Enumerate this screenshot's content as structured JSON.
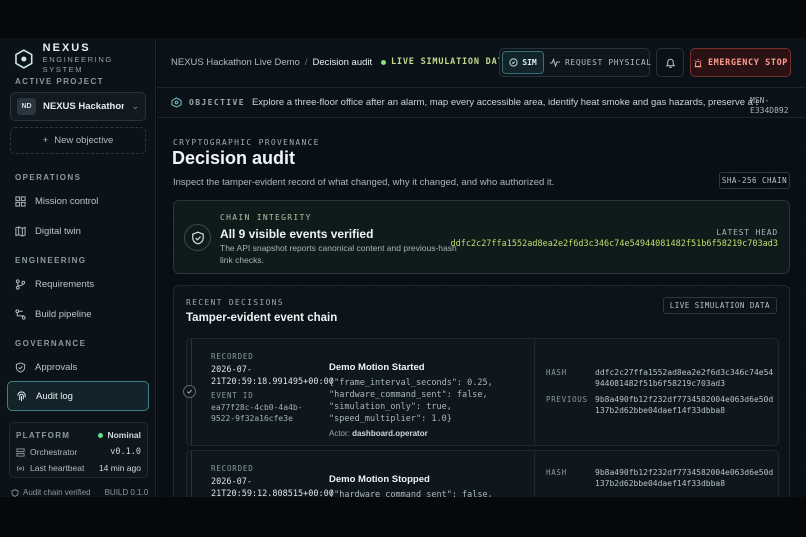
{
  "brand": {
    "name": "NEXUS",
    "subtitle": "ENGINEERING SYSTEM"
  },
  "sidebar": {
    "active_project_label": "ACTIVE PROJECT",
    "project": {
      "badge": "ND",
      "name": "NEXUS Hackathon ..."
    },
    "new_objective": "New objective",
    "sections": {
      "operations": "OPERATIONS",
      "engineering": "ENGINEERING",
      "governance": "GOVERNANCE"
    },
    "items": {
      "mission_control": "Mission control",
      "digital_twin": "Digital twin",
      "requirements": "Requirements",
      "build_pipeline": "Build pipeline",
      "approvals": "Approvals",
      "audit_log": "Audit log"
    },
    "platform": {
      "label": "PLATFORM",
      "status": "Nominal",
      "orchestrator_label": "Orchestrator",
      "orchestrator_version": "v0.1.0",
      "heartbeat_label": "Last heartbeat",
      "heartbeat_value": "14 min ago"
    },
    "footer": {
      "chain": "Audit chain verified",
      "build": "BUILD 0.1.0"
    }
  },
  "header": {
    "breadcrumb_parent": "NEXUS Hackathon Live Demo",
    "breadcrumb_sep": "/",
    "breadcrumb_current": "Decision audit",
    "live_badge": "LIVE SIMULATION DATA",
    "sim_label": "SIM",
    "request_label": "REQUEST PHYSICAL",
    "estop_label": "EMERGENCY STOP"
  },
  "objective": {
    "label": "OBJECTIVE",
    "text": "Explore a three-floor office after an alarm, map every accessible area, identify heat smoke and gas hazards, preserve a safe egress",
    "mission_id_line1": "MSN-",
    "mission_id_line2": "E334D892"
  },
  "page": {
    "eyebrow": "CRYPTOGRAPHIC PROVENANCE",
    "title": "Decision audit",
    "subtitle": "Inspect the tamper-evident record of what changed, why it changed, and who authorized it.",
    "sha_tag": "SHA-256 CHAIN"
  },
  "integrity": {
    "label": "CHAIN INTEGRITY",
    "title": "All 9 visible events verified",
    "description": "The API snapshot reports canonical content and previous-hash link checks.",
    "head_label": "LATEST HEAD",
    "head_hash": "ddfc2c27ffa1552ad8ea2e2f6d3c346c74e54944081482f51b6f58219c703ad3"
  },
  "recent": {
    "label": "RECENT DECISIONS",
    "title": "Tamper-evident event chain",
    "live_tag": "LIVE SIMULATION DATA",
    "recorded_label": "RECORDED",
    "event_id_label": "EVENT ID",
    "hash_label": "HASH",
    "previous_label": "PREVIOUS",
    "events": [
      {
        "time": "2026-07-21T20:59:18.991495+00:00",
        "event_id": "ea77f28c-4cb0-4a4b-9522-9f32a16cfe3e",
        "title": "Demo Motion Started",
        "payload": "{\"frame_interval_seconds\": 0.25, \"hardware_command_sent\": false, \"simulation_only\": true, \"speed_multiplier\": 1.0}",
        "actor_label": "Actor:",
        "actor": "dashboard.operator",
        "hash": "ddfc2c27ffa1552ad8ea2e2f6d3c346c74e54944081482f51b6f58219c703ad3",
        "previous": "9b8a490fb12f232df7734582004e063d6e50d137b2d62bbe04daef14f33dbba8"
      },
      {
        "time": "2026-07-21T20:59:12.808515+00:00",
        "title": "Demo Motion Stopped",
        "payload": "{\"hardware_command_sent\": false,",
        "hash": "9b8a490fb12f232df7734582004e063d6e50d137b2d62bbe04daef14f33dbba8"
      }
    ]
  },
  "colors": {
    "accent_teal": "#3f7f8a",
    "hash_green": "#b8e06b",
    "estop_red": "#ff9c8f",
    "status_green": "#5ee38a"
  },
  "icons": {
    "brand": "hexagon-icon",
    "mission_control": "grid-icon",
    "digital_twin": "map-icon",
    "requirements": "branch-icon",
    "build_pipeline": "pipeline-icon",
    "approvals": "shield-check-icon",
    "audit_log": "fingerprint-icon",
    "bell": "bell-icon",
    "estop": "siren-icon",
    "integrity": "shield-check-icon"
  }
}
